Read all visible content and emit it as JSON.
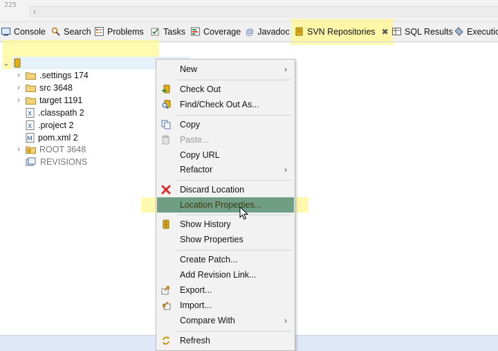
{
  "editor": {
    "line_number": "225"
  },
  "tabs": [
    {
      "label": "Console",
      "icon": "console-icon"
    },
    {
      "label": "Search",
      "icon": "search-icon"
    },
    {
      "label": "Problems",
      "icon": "problems-icon"
    },
    {
      "label": "Tasks",
      "icon": "tasks-icon"
    },
    {
      "label": "Coverage",
      "icon": "coverage-icon"
    },
    {
      "label": "Javadoc",
      "icon": "at-sign-icon"
    },
    {
      "label": "SVN Repositories",
      "icon": "svn-repository-icon"
    },
    {
      "label": "SQL Results",
      "icon": "sql-results-icon"
    },
    {
      "label": "Executio",
      "icon": "execution-plan-icon"
    }
  ],
  "tree": {
    "root_label": "",
    "children": [
      {
        "label": ".settings 174",
        "icon": "folder-icon",
        "expandable": true
      },
      {
        "label": "src 3648",
        "icon": "folder-icon",
        "expandable": true
      },
      {
        "label": "target 1191",
        "icon": "folder-icon",
        "expandable": true
      },
      {
        "label": ".classpath 2",
        "icon": "xml-file-icon",
        "expandable": false
      },
      {
        "label": ".project 2",
        "icon": "xml-file-icon",
        "expandable": false
      },
      {
        "label": "pom.xml 2",
        "icon": "maven-file-icon",
        "expandable": false
      },
      {
        "label": "ROOT 3648",
        "icon": "svn-folder-icon",
        "expandable": true
      },
      {
        "label": "REVISIONS",
        "icon": "revisions-icon",
        "expandable": false
      }
    ]
  },
  "context_menu": {
    "items": [
      {
        "label": "New",
        "submenu": true
      },
      {
        "label": "Check Out",
        "icon": "checkout-icon"
      },
      {
        "label": "Find/Check Out As...",
        "icon": "find-checkout-icon"
      },
      {
        "label": "Copy",
        "icon": "copy-icon"
      },
      {
        "label": "Paste...",
        "icon": "paste-icon",
        "disabled": true
      },
      {
        "label": "Copy URL"
      },
      {
        "label": "Refactor",
        "submenu": true
      },
      {
        "label": "Discard Location",
        "icon": "red-x-icon"
      },
      {
        "label": "Location Properties...",
        "selected": true
      },
      {
        "label": "Show History",
        "icon": "history-icon"
      },
      {
        "label": "Show Properties"
      },
      {
        "label": "Create Patch..."
      },
      {
        "label": "Add Revision Link..."
      },
      {
        "label": "Export...",
        "icon": "export-icon"
      },
      {
        "label": "Import...",
        "icon": "import-icon"
      },
      {
        "label": "Compare With",
        "submenu": true
      },
      {
        "label": "Refresh",
        "icon": "refresh-icon"
      }
    ]
  },
  "colors": {
    "highlight_yellow": "#fff578",
    "menu_selection": "#6f9e85",
    "tab_bar": "#f0f0f0",
    "status_bar": "#dfe8f6"
  }
}
